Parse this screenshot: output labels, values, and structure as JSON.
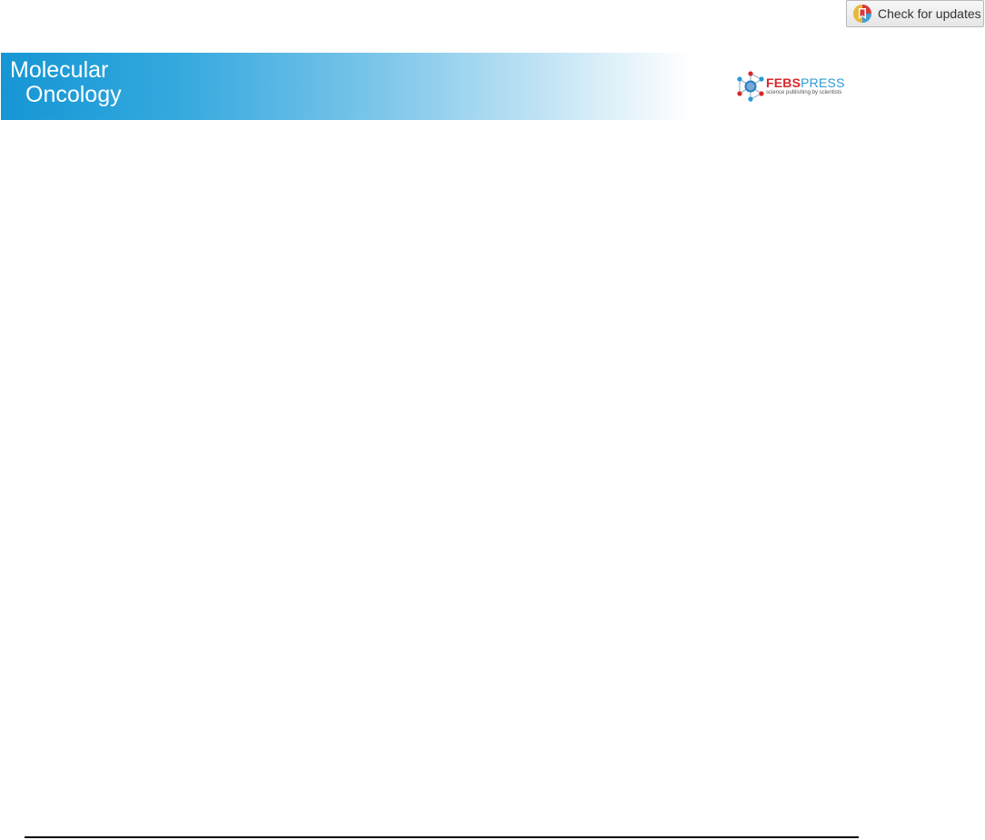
{
  "update_check": {
    "label": "Check for updates",
    "icon": "crossmark-icon"
  },
  "journal": {
    "title_line1": "Molecular",
    "title_line2": "Oncology",
    "banner_color_start": "#1596d4",
    "banner_color_end": "#ffffff"
  },
  "publisher": {
    "name_part1": "FEBS",
    "name_part2": "PRESS",
    "tagline": "science publishing by scientists",
    "icon": "febs-network-icon",
    "color_febs": "#d8282a",
    "color_press": "#2a9ad6"
  }
}
